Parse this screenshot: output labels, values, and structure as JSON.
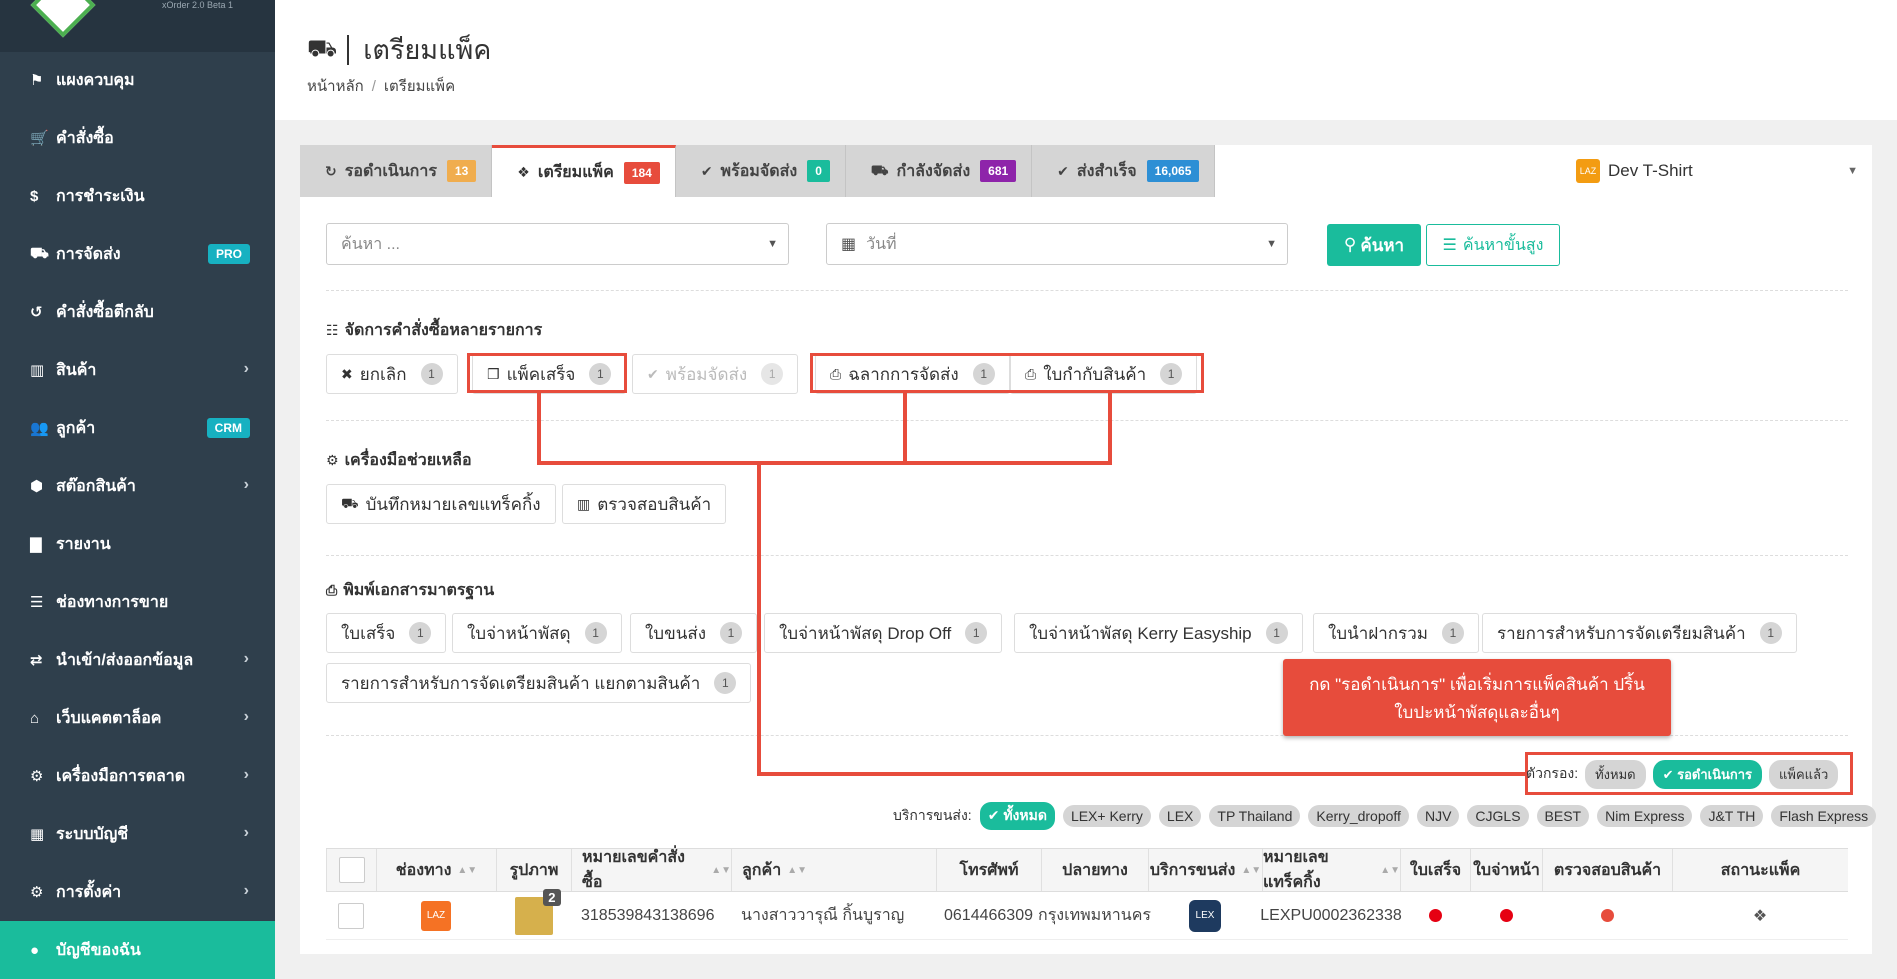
{
  "app": {
    "version": "xOrder 2.0 Beta 1"
  },
  "sidebar": {
    "items": [
      {
        "label": "แผงควบคุม",
        "icon": "flag-icon",
        "glyph": "⚑"
      },
      {
        "label": "คำสั่งซื้อ",
        "icon": "cart-icon",
        "glyph": "🛒"
      },
      {
        "label": "การชำระเงิน",
        "icon": "dollar-icon",
        "glyph": "$"
      },
      {
        "label": "การจัดส่ง",
        "icon": "truck-icon",
        "glyph": "⛟",
        "badge": "PRO"
      },
      {
        "label": "คำสั่งซื้อตีกลับ",
        "icon": "undo-icon",
        "glyph": "↺"
      },
      {
        "label": "สินค้า",
        "icon": "barcode-icon",
        "glyph": "▥",
        "chevron": true
      },
      {
        "label": "ลูกค้า",
        "icon": "users-icon",
        "glyph": "👥",
        "badge": "CRM"
      },
      {
        "label": "สต๊อกสินค้า",
        "icon": "cubes-icon",
        "glyph": "⬢",
        "chevron": true
      },
      {
        "label": "รายงาน",
        "icon": "bar-chart-icon",
        "glyph": "▇"
      },
      {
        "label": "ช่องทางการขาย",
        "icon": "list-icon",
        "glyph": "☰"
      },
      {
        "label": "นำเข้า/ส่งออกข้อมูล",
        "icon": "exchange-icon",
        "glyph": "⇄",
        "chevron": true
      },
      {
        "label": "เว็บแคตตาล็อค",
        "icon": "shop-icon",
        "glyph": "⌂",
        "chevron": true
      },
      {
        "label": "เครื่องมือการตลาด",
        "icon": "marketing-icon",
        "glyph": "⚙",
        "chevron": true
      },
      {
        "label": "ระบบบัญชี",
        "icon": "calculator-icon",
        "glyph": "▦",
        "chevron": true
      },
      {
        "label": "การตั้งค่า",
        "icon": "settings-icon",
        "glyph": "⚙",
        "chevron": true
      },
      {
        "label": "บัญชีของฉัน",
        "icon": "account-icon",
        "glyph": "●",
        "active": true
      }
    ]
  },
  "header": {
    "title": "เตรียมแพ็ค",
    "breadcrumb": [
      "หน้าหลัก",
      "เตรียมแพ็ค"
    ]
  },
  "tabs": [
    {
      "label": "รอดำเนินการ",
      "count": "13",
      "color": "#f0ad4e",
      "glyph": "↻"
    },
    {
      "label": "เตรียมแพ็ค",
      "count": "184",
      "color": "#e74c3c",
      "glyph": "❖",
      "active": true
    },
    {
      "label": "พร้อมจัดส่ง",
      "count": "0",
      "color": "#1abc9c",
      "glyph": "✔"
    },
    {
      "label": "กำลังจัดส่ง",
      "count": "681",
      "color": "#8e24aa",
      "glyph": "⛟"
    },
    {
      "label": "ส่งสำเร็จ",
      "count": "16,065",
      "color": "#2d8fd5",
      "glyph": "✔"
    }
  ],
  "shop": {
    "name": "Dev T-Shirt"
  },
  "search": {
    "placeholder": "ค้นหา ...",
    "date_placeholder": "วันที่",
    "search_label": "ค้นหา",
    "advanced_label": "ค้นหาขั้นสูง"
  },
  "bulk": {
    "title": "จัดการคำสั่งซื้อหลายรายการ",
    "buttons": [
      {
        "label": "ยกเลิก",
        "count": "1"
      },
      {
        "label": "แพ็คเสร็จ",
        "count": "1"
      },
      {
        "label": "พร้อมจัดส่ง",
        "count": "1"
      },
      {
        "label": "ฉลากการจัดส่ง",
        "count": "1"
      },
      {
        "label": "ใบกำกับสินค้า",
        "count": "1"
      }
    ]
  },
  "tools": {
    "title": "เครื่องมือช่วยเหลือ",
    "buttons": [
      "บันทึกหมายเลขแทร็คกิ้ง",
      "ตรวจสอบสินค้า"
    ]
  },
  "print": {
    "title": "พิมพ์เอกสารมาตรฐาน",
    "buttons": [
      {
        "label": "ใบเสร็จ",
        "count": "1"
      },
      {
        "label": "ใบจ่าหน้าพัสดุ",
        "count": "1"
      },
      {
        "label": "ใบขนส่ง",
        "count": "1"
      },
      {
        "label": "ใบจ่าหน้าพัสดุ Drop Off",
        "count": "1"
      },
      {
        "label": "ใบจ่าหน้าพัสดุ Kerry Easyship",
        "count": "1"
      },
      {
        "label": "ใบนำฝากรวม",
        "count": "1"
      },
      {
        "label": "รายการสำหรับการจัดเตรียมสินค้า",
        "count": "1"
      },
      {
        "label": "รายการสำหรับการจัดเตรียมสินค้า แยกตามสินค้า",
        "count": "1"
      }
    ]
  },
  "callout": {
    "line1": "กด \"รอดำเนินการ\" เพื่อเริ่มการแพ็คสินค้า ปริ้น",
    "line2": "ใบปะหน้าพัสดุและอื่นๆ"
  },
  "filter": {
    "label": "ตัวกรอง:",
    "options": [
      "ทั้งหมด",
      "รอดำเนินการ",
      "แพ็คแล้ว"
    ]
  },
  "carriers": {
    "label": "บริการขนส่ง:",
    "options": [
      "ทั้งหมด",
      "LEX+ Kerry",
      "LEX",
      "TP Thailand",
      "Kerry_dropoff",
      "NJV",
      "CJGLS",
      "BEST",
      "Nim Express",
      "J&T TH",
      "Flash Express"
    ]
  },
  "table": {
    "headers": [
      "ช่องทาง",
      "รูปภาพ",
      "หมายเลขคำสั่งซื้อ",
      "ลูกค้า",
      "โทรศัพท์",
      "ปลายทาง",
      "บริการขนส่ง",
      "หมายเลขแทร็คกิ้ง",
      "ใบเสร็จ",
      "ใบจ่าหน้า",
      "ตรวจสอบสินค้า",
      "สถานะแพ็ค"
    ],
    "rows": [
      {
        "image_count": "2",
        "order_no": "318539843138696",
        "customer": "นางสาววารุณี กิ้นบูราญ",
        "phone": "0614466309",
        "destination": "กรุงเทพมหานคร",
        "tracking": "LEXPU0002362338"
      }
    ]
  }
}
